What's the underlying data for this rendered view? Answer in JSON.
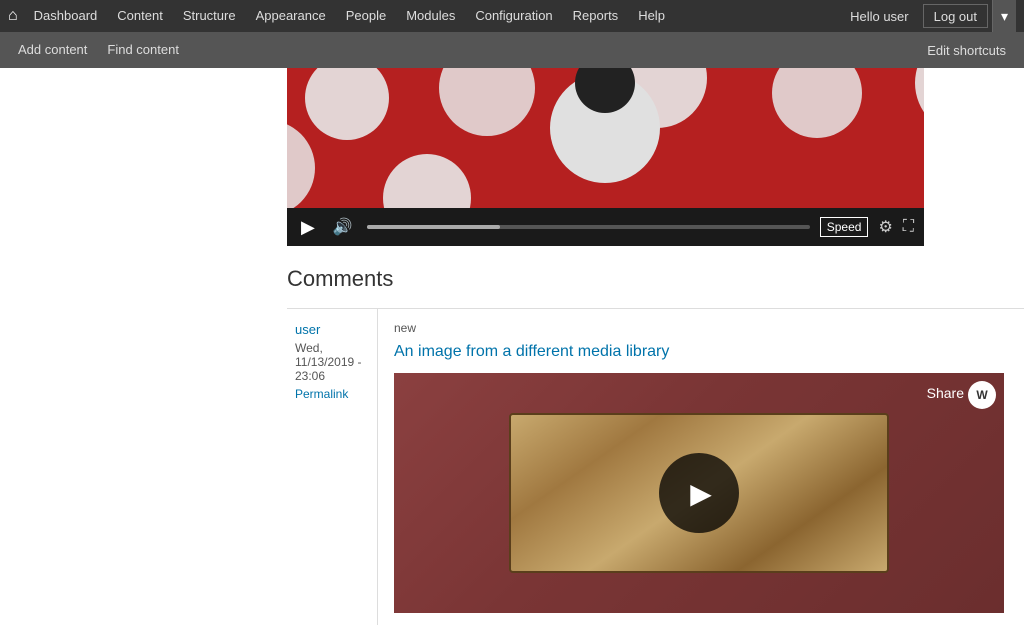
{
  "nav": {
    "home_icon": "⌂",
    "items": [
      {
        "label": "Dashboard",
        "id": "dashboard"
      },
      {
        "label": "Content",
        "id": "content"
      },
      {
        "label": "Structure",
        "id": "structure"
      },
      {
        "label": "Appearance",
        "id": "appearance"
      },
      {
        "label": "People",
        "id": "people"
      },
      {
        "label": "Modules",
        "id": "modules"
      },
      {
        "label": "Configuration",
        "id": "configuration"
      },
      {
        "label": "Reports",
        "id": "reports"
      },
      {
        "label": "Help",
        "id": "help"
      }
    ],
    "hello_user": "Hello user",
    "logout_label": "Log out",
    "dropdown_icon": "▾"
  },
  "toolbar": {
    "add_content": "Add content",
    "find_content": "Find content",
    "edit_shortcuts": "Edit shortcuts"
  },
  "video": {
    "speed_label": "Speed",
    "settings_icon": "⚙",
    "fullscreen_icon": "⛶"
  },
  "comments": {
    "title": "Comments",
    "badge": "new",
    "article_title": "An image from a different media library",
    "share_label": "Share",
    "w_icon": "W",
    "author": {
      "name": "user",
      "date": "Wed, 11/13/2019 - 23:06",
      "permalink": "Permalink"
    }
  }
}
